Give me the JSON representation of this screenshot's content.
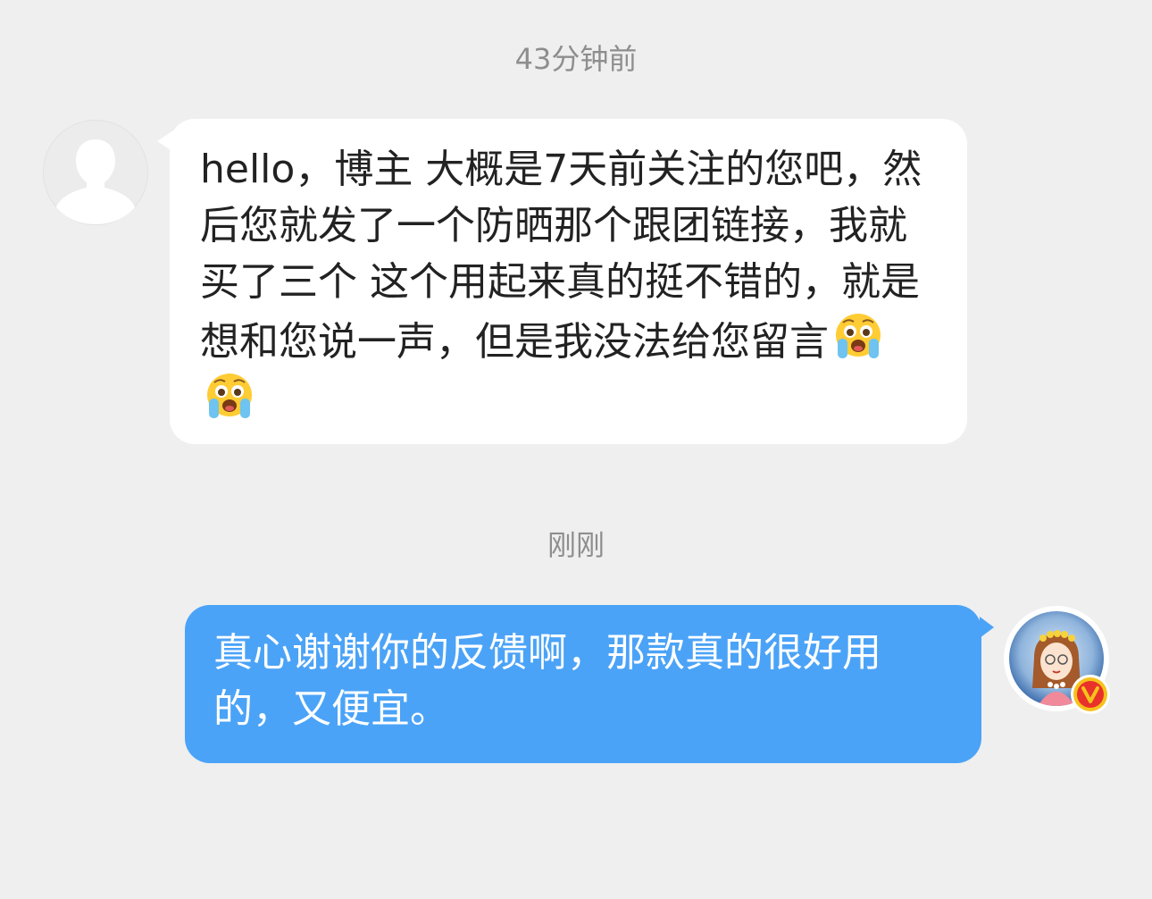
{
  "conversation": {
    "messages": [
      {
        "timestamp": "43分钟前",
        "sender": "other",
        "avatar_icon": "default-user-avatar",
        "text": "hello，博主 大概是7天前关注的您吧，然后您就发了一个防晒那个跟团链接，我就买了三个 这个用起来真的挺不错的，就是想和您说一声，但是我没法给您留言",
        "emojis": [
          "loudly-crying-face-emoji",
          "loudly-crying-face-emoji"
        ]
      },
      {
        "timestamp": "刚刚",
        "sender": "self",
        "avatar_icon": "illustrated-girl-avatar",
        "badge_icon": "verified-v-badge",
        "text": "真心谢谢你的反馈啊，那款真的很好用的，又便宜。"
      }
    ]
  },
  "colors": {
    "background": "#efefef",
    "incoming_bubble": "#ffffff",
    "outgoing_bubble": "#4ba3f7",
    "timestamp_text": "#8e8e8e",
    "verified_badge": "#e8322a",
    "verified_badge_ring": "#f6c21c"
  }
}
